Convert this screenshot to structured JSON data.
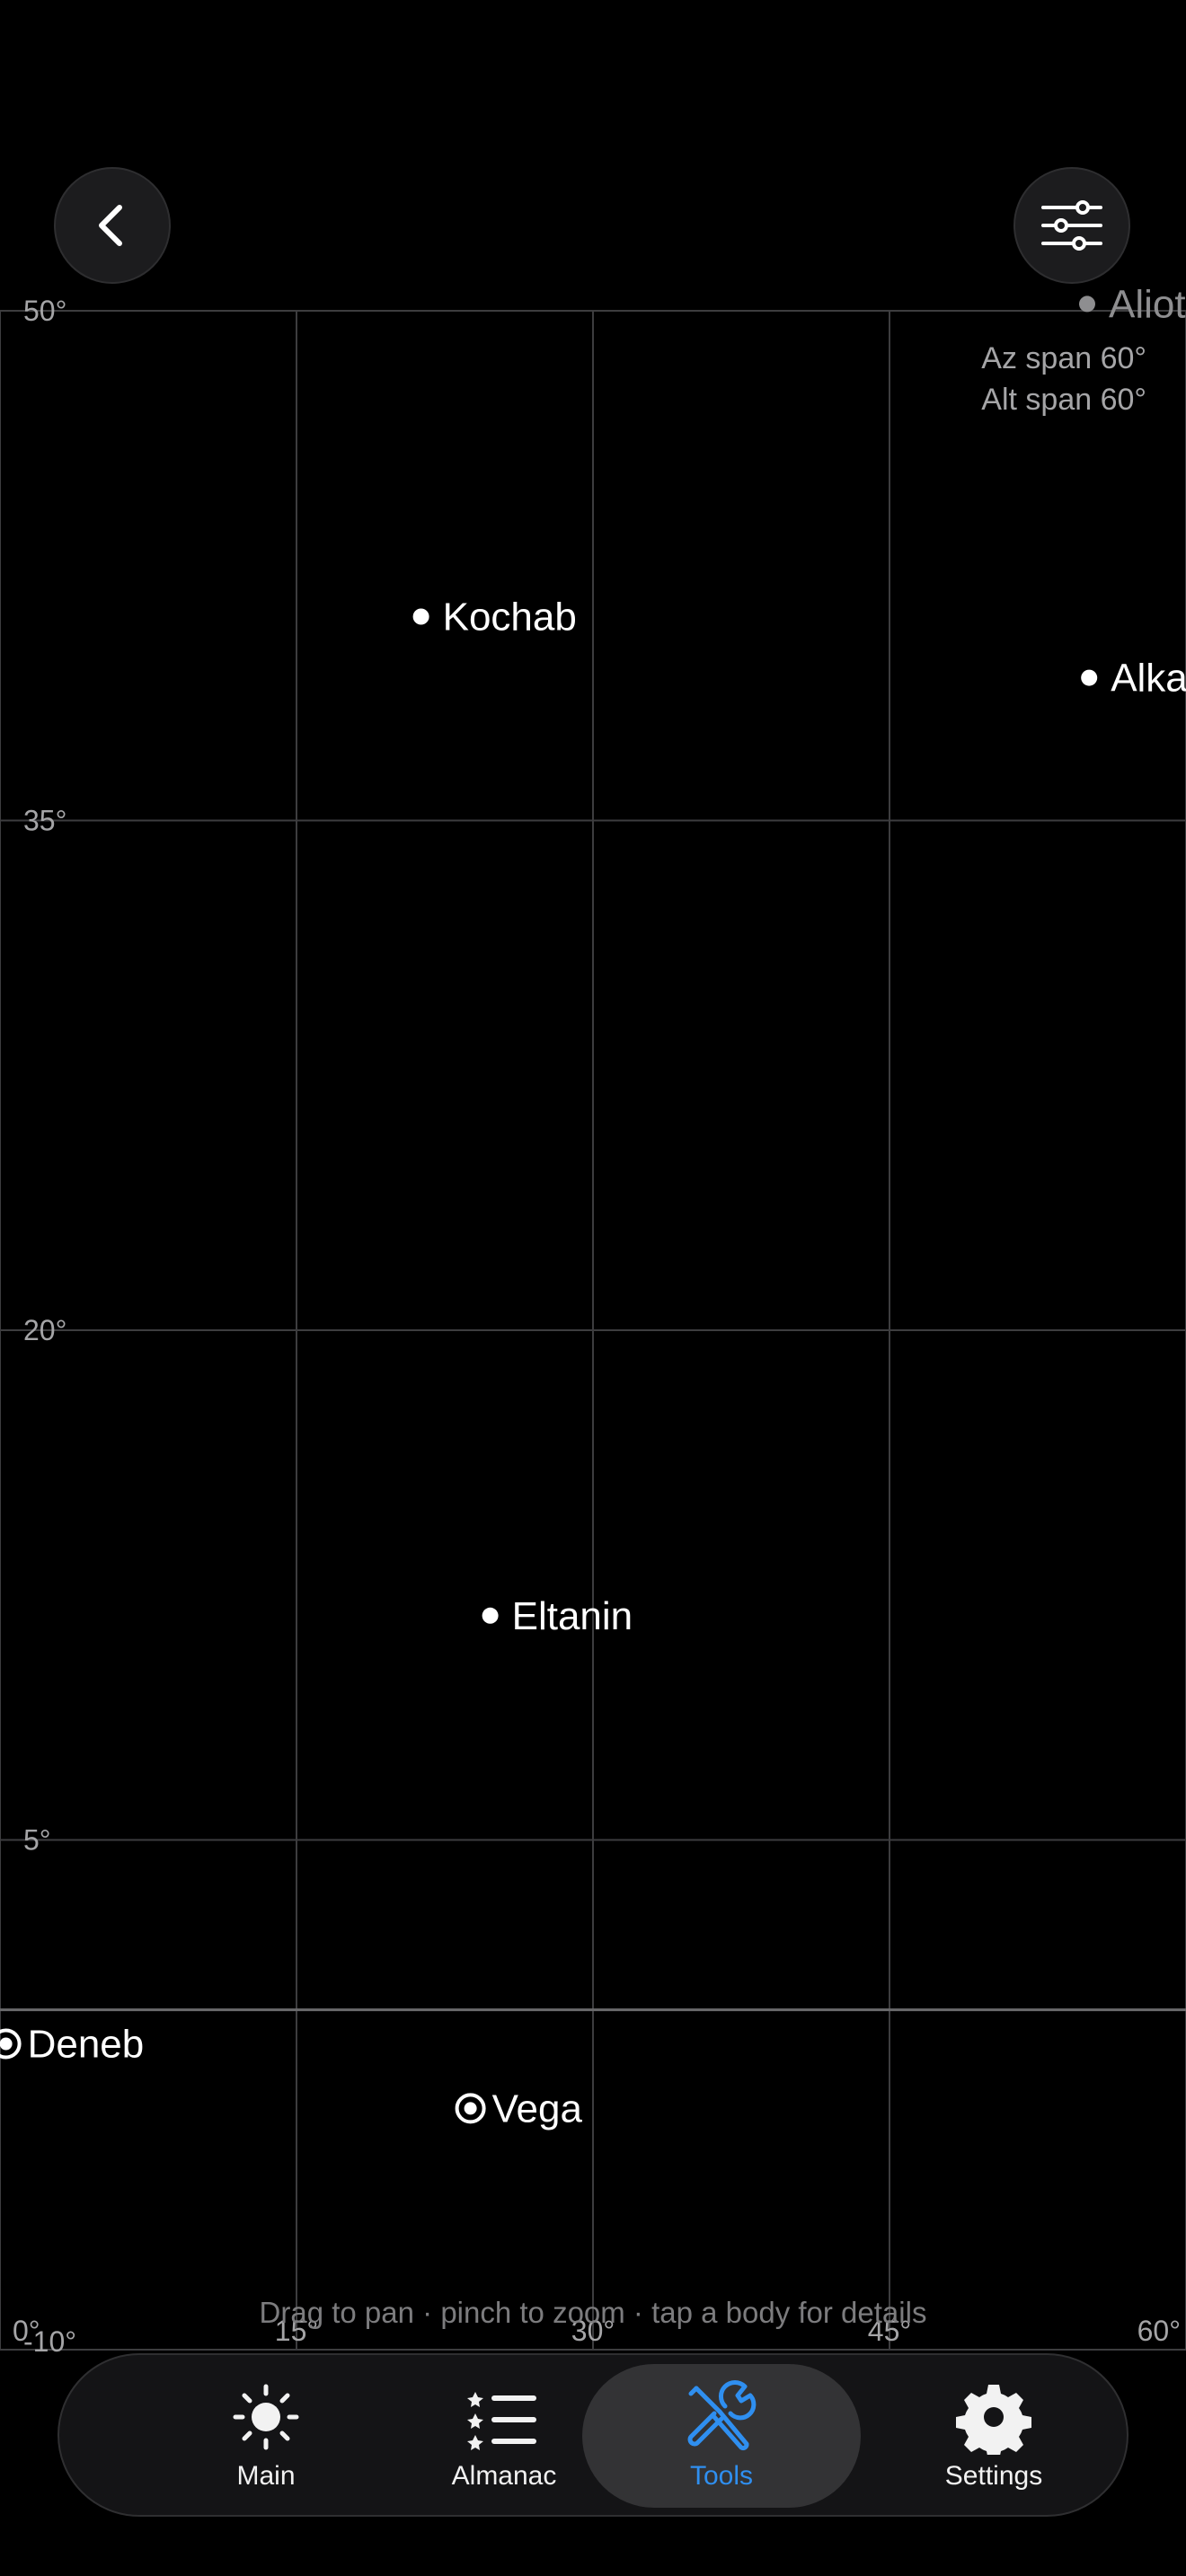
{
  "header": {
    "back_icon": "chevron-left-icon",
    "filter_icon": "sliders-icon"
  },
  "sky_plot": {
    "az_span": "Az span 60°",
    "alt_span": "Alt span 60°",
    "alt_ticks": [
      "50°",
      "35°",
      "20°",
      "5°",
      "-10°"
    ],
    "az_ticks": [
      "0°",
      "15°",
      "30°",
      "45°",
      "60°"
    ],
    "azimuth_range": [
      0,
      60
    ],
    "altitude_range": [
      -10,
      50
    ],
    "grid": true,
    "horizon_altitude": 0,
    "stars": [
      {
        "name": "Alioth",
        "az": 55,
        "alt": 50.2,
        "marker": "dot",
        "dimmed": true
      },
      {
        "name": "Kochab",
        "az": 21.3,
        "alt": 41,
        "marker": "dot",
        "dimmed": false
      },
      {
        "name": "Alka",
        "az": 55.1,
        "alt": 39.2,
        "marker": "dot",
        "dimmed": false
      },
      {
        "name": "Eltanin",
        "az": 24.8,
        "alt": 11.6,
        "marker": "dot",
        "dimmed": false
      },
      {
        "name": "Deneb",
        "az": 0.3,
        "alt": -1.0,
        "marker": "ring",
        "dimmed": false
      },
      {
        "name": "Vega",
        "az": 23.8,
        "alt": -2.9,
        "marker": "ring",
        "dimmed": false
      }
    ],
    "colors": {
      "background": "#000000",
      "grid": "#3d3d3f",
      "star": "#ffffff"
    }
  },
  "hint": "Drag to pan · pinch to zoom · tap a body for details",
  "tabs": [
    {
      "label": "Main",
      "icon": "sun-icon",
      "active": false
    },
    {
      "label": "Almanac",
      "icon": "list-icon",
      "active": false
    },
    {
      "label": "Tools",
      "icon": "tools-icon",
      "active": true
    },
    {
      "label": "Settings",
      "icon": "gear-icon",
      "active": false
    }
  ],
  "accent_color": "#2f8ff0"
}
